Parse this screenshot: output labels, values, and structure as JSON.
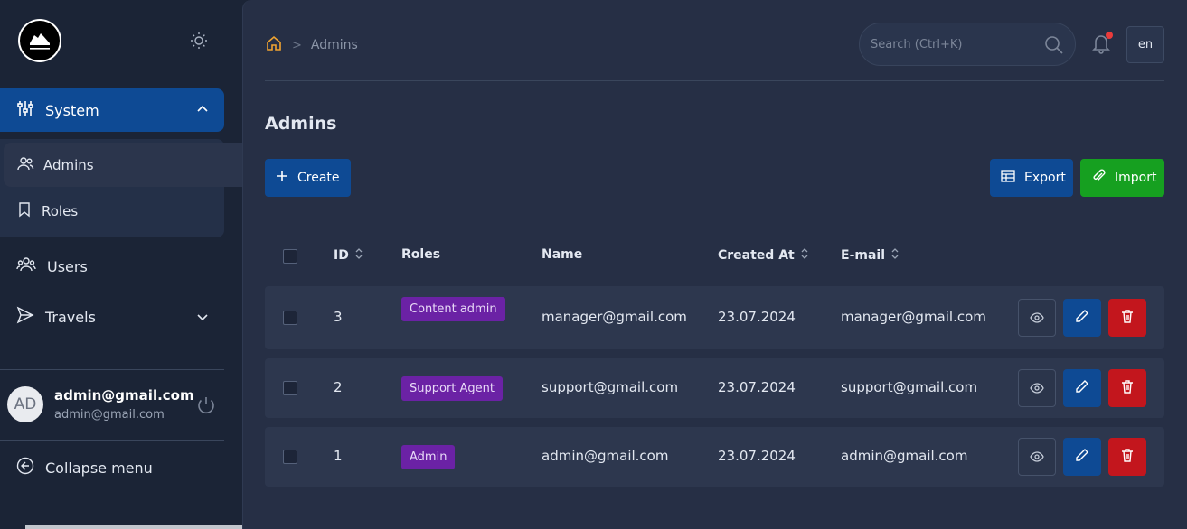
{
  "sidebar": {
    "nav": {
      "system": "System",
      "admins": "Admins",
      "roles": "Roles",
      "users": "Users",
      "travels": "Travels"
    },
    "user": {
      "initials": "AD",
      "name": "admin@gmail.com",
      "email": "admin@gmail.com"
    },
    "collapse": "Collapse menu"
  },
  "header": {
    "breadcrumb": "Admins",
    "search_placeholder": "Search (Ctrl+K)",
    "lang": "en"
  },
  "page": {
    "title": "Admins",
    "create": "Create",
    "export": "Export",
    "import": "Import"
  },
  "table": {
    "headers": {
      "id": "ID",
      "roles": "Roles",
      "name": "Name",
      "created_at": "Created At",
      "email": "E-mail"
    },
    "rows": [
      {
        "id": "3",
        "role": "Content admin",
        "name": "manager@gmail.com",
        "created_at": "23.07.2024",
        "email": "manager@gmail.com"
      },
      {
        "id": "2",
        "role": "Support Agent",
        "name": "support@gmail.com",
        "created_at": "23.07.2024",
        "email": "support@gmail.com"
      },
      {
        "id": "1",
        "role": "Admin",
        "name": "admin@gmail.com",
        "created_at": "23.07.2024",
        "email": "admin@gmail.com"
      }
    ]
  },
  "colors": {
    "primary": "#0e4a94",
    "success": "#16a020",
    "danger": "#c3161d",
    "role_badge": "#6b22a5",
    "home_icon": "#f0a431",
    "notification_dot": "#ea3b3b"
  },
  "icons": [
    "logo-icon",
    "sun-icon",
    "sliders-icon",
    "chevron-up-icon",
    "users-icon",
    "bookmark-icon",
    "people-icon",
    "send-icon",
    "chevron-down-icon",
    "power-icon",
    "arrow-left-circle-icon",
    "home-icon",
    "search-icon",
    "bell-icon",
    "plus-icon",
    "table-icon",
    "paperclip-icon",
    "sort-icon",
    "eye-icon",
    "pencil-icon",
    "trash-icon"
  ]
}
